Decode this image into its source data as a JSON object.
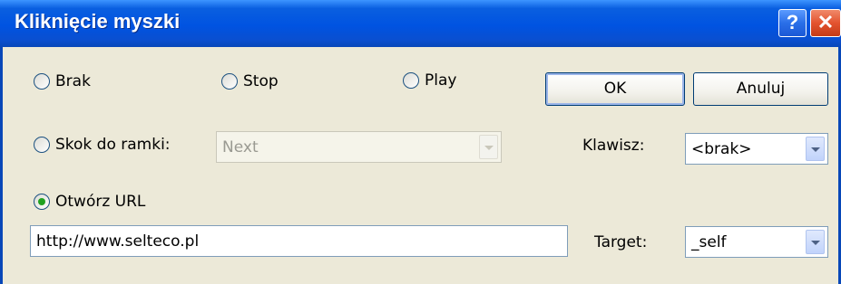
{
  "window": {
    "title": "Kliknięcie myszki",
    "help_glyph": "?",
    "close_glyph": "✕"
  },
  "actions": {
    "options": [
      {
        "label": "Brak",
        "selected": false
      },
      {
        "label": "Stop",
        "selected": false
      },
      {
        "label": "Play",
        "selected": false
      },
      {
        "label": "Skok do ramki:",
        "selected": false
      },
      {
        "label": "Otwórz URL",
        "selected": true
      }
    ]
  },
  "frame_select": {
    "value": "Next",
    "disabled": true
  },
  "key": {
    "label": "Klawisz:",
    "value": "<brak>"
  },
  "url": {
    "value": "http://www.selteco.pl"
  },
  "target": {
    "label": "Target:",
    "value": "_self"
  },
  "buttons": {
    "ok": "OK",
    "cancel": "Anuluj"
  },
  "colors": {
    "titlebar": "#0053e1",
    "dialog_bg": "#ece9d8",
    "radio_dot": "#21a121"
  }
}
